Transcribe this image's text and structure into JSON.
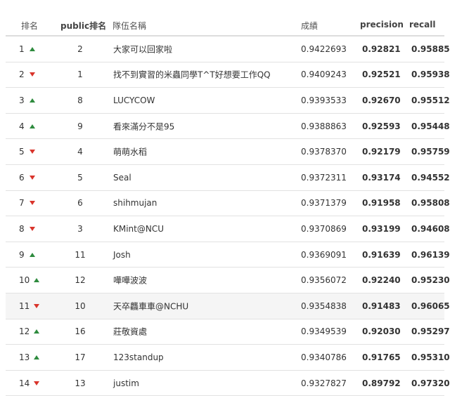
{
  "header": {
    "rank": "排名",
    "public_rank": "public排名",
    "team": "隊伍名稱",
    "score": "成績",
    "precision": "precision",
    "recall": "recall"
  },
  "rows": [
    {
      "rank": "1",
      "trend": "up",
      "public_rank": "2",
      "team": "大家可以回家啦",
      "score": "0.9422693",
      "precision": "0.92821",
      "recall": "0.95885"
    },
    {
      "rank": "2",
      "trend": "down",
      "public_rank": "1",
      "team": "找不到實習的米蟲同學T^T好想要工作QQ",
      "score": "0.9409243",
      "precision": "0.92521",
      "recall": "0.95938"
    },
    {
      "rank": "3",
      "trend": "up",
      "public_rank": "8",
      "team": "LUCYCOW",
      "score": "0.9393533",
      "precision": "0.92670",
      "recall": "0.95512"
    },
    {
      "rank": "4",
      "trend": "up",
      "public_rank": "9",
      "team": "看來滿分不是95",
      "score": "0.9388863",
      "precision": "0.92593",
      "recall": "0.95448"
    },
    {
      "rank": "5",
      "trend": "down",
      "public_rank": "4",
      "team": "萌萌水稻",
      "score": "0.9378370",
      "precision": "0.92179",
      "recall": "0.95759"
    },
    {
      "rank": "6",
      "trend": "down",
      "public_rank": "5",
      "team": "Seal",
      "score": "0.9372311",
      "precision": "0.93174",
      "recall": "0.94552"
    },
    {
      "rank": "7",
      "trend": "down",
      "public_rank": "6",
      "team": "shihmujan",
      "score": "0.9371379",
      "precision": "0.91958",
      "recall": "0.95808"
    },
    {
      "rank": "8",
      "trend": "down",
      "public_rank": "3",
      "team": "KMint@NCU",
      "score": "0.9370869",
      "precision": "0.93199",
      "recall": "0.94608"
    },
    {
      "rank": "9",
      "trend": "up",
      "public_rank": "11",
      "team": "Josh",
      "score": "0.9369091",
      "precision": "0.91639",
      "recall": "0.96139"
    },
    {
      "rank": "10",
      "trend": "up",
      "public_rank": "12",
      "team": "嘩嘩波波",
      "score": "0.9356072",
      "precision": "0.92240",
      "recall": "0.95230"
    },
    {
      "rank": "11",
      "trend": "down",
      "public_rank": "10",
      "team": "天卒龘車車@NCHU",
      "score": "0.9354838",
      "precision": "0.91483",
      "recall": "0.96065"
    },
    {
      "rank": "12",
      "trend": "up",
      "public_rank": "16",
      "team": "莊敬資處",
      "score": "0.9349539",
      "precision": "0.92030",
      "recall": "0.95297"
    },
    {
      "rank": "13",
      "trend": "up",
      "public_rank": "17",
      "team": "123standup",
      "score": "0.9340786",
      "precision": "0.91765",
      "recall": "0.95310"
    },
    {
      "rank": "14",
      "trend": "down",
      "public_rank": "13",
      "team": "justim",
      "score": "0.9327827",
      "precision": "0.89792",
      "recall": "0.97320"
    }
  ],
  "colors": {
    "up": "#2e8b3e",
    "down": "#d9342b"
  }
}
